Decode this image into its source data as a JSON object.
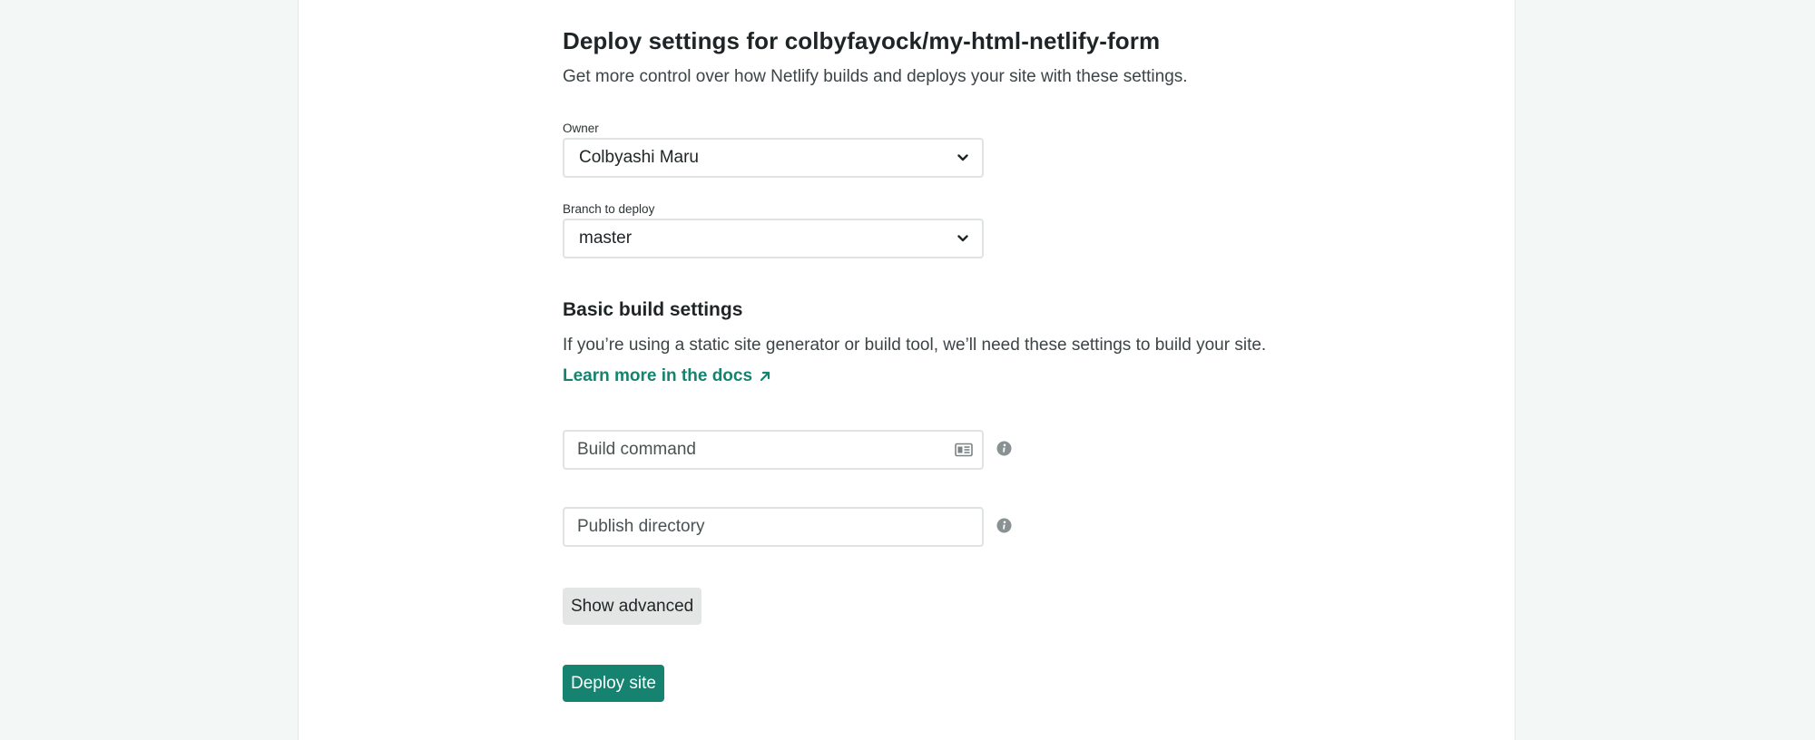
{
  "header": {
    "title": "Deploy settings for colbyfayock/my-html-netlify-form",
    "subtitle": "Get more control over how Netlify builds and deploys your site with these settings."
  },
  "owner": {
    "label": "Owner",
    "value": "Colbyashi Maru"
  },
  "branch": {
    "label": "Branch to deploy",
    "value": "master"
  },
  "build_settings": {
    "title": "Basic build settings",
    "description": "If you’re using a static site generator or build tool, we’ll need these settings to build your site.",
    "docs_link": "Learn more in the docs",
    "build_command": {
      "placeholder": "Build command",
      "value": ""
    },
    "publish_directory": {
      "placeholder": "Publish directory",
      "value": ""
    }
  },
  "buttons": {
    "show_advanced": "Show advanced",
    "deploy_site": "Deploy site"
  },
  "colors": {
    "accent": "#168370",
    "link": "#16836e",
    "background": "#f3f7f6"
  },
  "icons": {
    "select_chevron": "chevron-down-icon",
    "docs_arrow": "arrow-up-right-icon",
    "build_command_field": "form-card-icon",
    "info": "info-icon"
  }
}
